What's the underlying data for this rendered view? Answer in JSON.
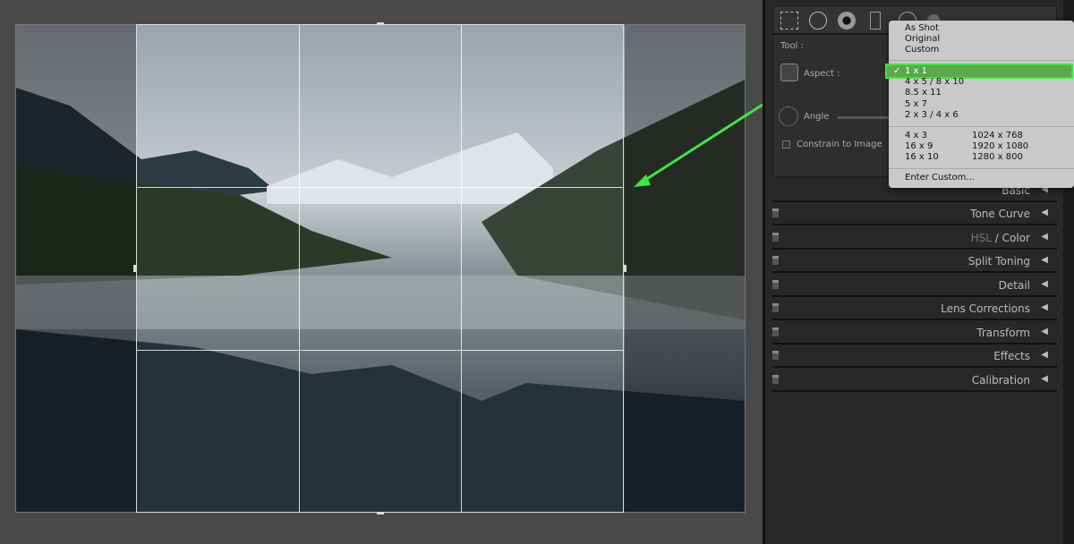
{
  "tool_panel": {
    "tool_label": "Tool :",
    "aspect_label": "Aspect :",
    "angle_label": "Angle",
    "constrain_label": "Constrain to Image",
    "constrain_checked": false
  },
  "toolbar": {
    "icons": [
      "crop-overlay-icon",
      "spot-removal-icon",
      "red-eye-icon",
      "graduated-filter-icon",
      "radial-filter-icon",
      "adjustment-brush-icon"
    ]
  },
  "aspect_menu": {
    "items_top": [
      "As Shot",
      "Original",
      "Custom"
    ],
    "selected": "1 x 1",
    "items_mid": [
      "4 x 5  /  8 x 10",
      "8.5 x 11",
      "5 x 7",
      "2 x 3  /  4 x 6"
    ],
    "items_left": [
      "4 x 3",
      "16 x 9",
      "16 x 10"
    ],
    "items_right": [
      "1024 x 768",
      "1920 x 1080",
      "1280 x 800"
    ],
    "enter_custom": "Enter Custom..."
  },
  "sections": [
    {
      "label": "Basic"
    },
    {
      "label": "Tone Curve"
    },
    {
      "label_dim": "HSL",
      "label_sep": " / ",
      "label": "Color"
    },
    {
      "label": "Split Toning"
    },
    {
      "label": "Detail"
    },
    {
      "label": "Lens Corrections"
    },
    {
      "label": "Transform"
    },
    {
      "label": "Effects"
    },
    {
      "label": "Calibration"
    }
  ],
  "colors": {
    "highlight": "#5da84a",
    "annotation": "#3fe63f",
    "panel": "#282828"
  }
}
